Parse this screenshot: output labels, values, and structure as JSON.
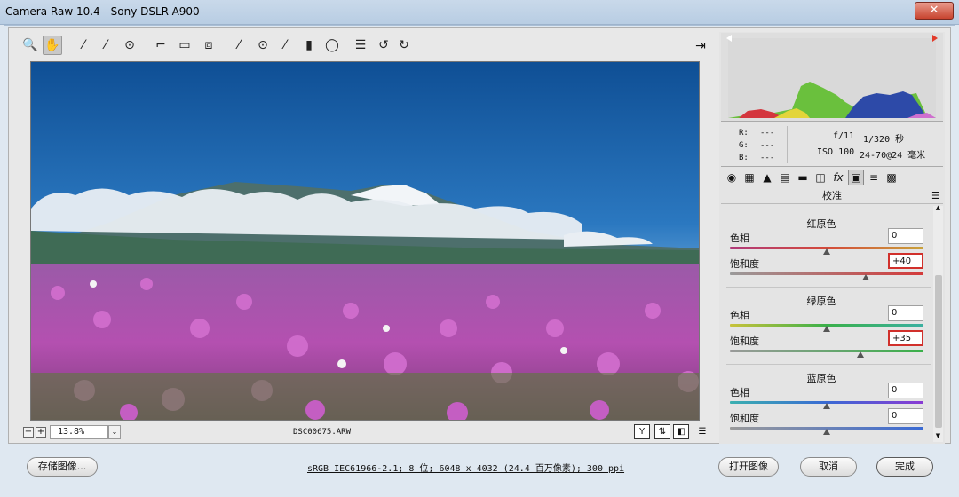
{
  "window": {
    "title": "Camera Raw 10.4 -  Sony DSLR-A900",
    "close_glyph": "✕"
  },
  "toolbar": {
    "tools": [
      {
        "name": "zoom-tool-icon",
        "glyph": "🔍"
      },
      {
        "name": "hand-tool-icon",
        "glyph": "✋"
      },
      {
        "name": "white-balance-tool-icon",
        "glyph": "⁄"
      },
      {
        "name": "color-sampler-tool-icon",
        "glyph": "⁄"
      },
      {
        "name": "targeted-adjustment-tool-icon",
        "glyph": "⊙"
      },
      {
        "name": "crop-tool-icon",
        "glyph": "⌐"
      },
      {
        "name": "straighten-tool-icon",
        "glyph": "▭"
      },
      {
        "name": "transform-tool-icon",
        "glyph": "⧈"
      },
      {
        "name": "spot-removal-tool-icon",
        "glyph": "⁄"
      },
      {
        "name": "red-eye-tool-icon",
        "glyph": "⊙"
      },
      {
        "name": "adjustment-brush-icon",
        "glyph": "⁄"
      },
      {
        "name": "graduated-filter-icon",
        "glyph": "▮"
      },
      {
        "name": "radial-filter-icon",
        "glyph": "◯"
      },
      {
        "name": "preferences-icon",
        "glyph": "☰"
      },
      {
        "name": "rotate-left-icon",
        "glyph": "↺"
      },
      {
        "name": "rotate-right-icon",
        "glyph": "↻"
      }
    ],
    "export_glyph": "⇥"
  },
  "preview": {
    "zoom_out": "−",
    "zoom_in": "+",
    "zoom_value": "13.8%",
    "zoom_dropdown": "⌄",
    "filename": "DSC00675.ARW",
    "icons": [
      {
        "name": "before-after-toggle-icon",
        "glyph": "Y"
      },
      {
        "name": "swap-settings-icon",
        "glyph": "⇅"
      },
      {
        "name": "copy-settings-icon",
        "glyph": "◧"
      },
      {
        "name": "default-settings-icon",
        "glyph": "☰"
      }
    ]
  },
  "info": {
    "r_label": "R:",
    "r_value": "---",
    "g_label": "G:",
    "g_value": "---",
    "b_label": "B:",
    "b_value": "---",
    "aperture": "f/11",
    "shutter": "1/320 秒",
    "iso": "ISO 100",
    "lens": "24-70@24 毫米"
  },
  "panel": {
    "title": "校准",
    "menu_glyph": "☰",
    "tabs": [
      {
        "name": "basic-tab-icon",
        "glyph": "◉"
      },
      {
        "name": "tone-curve-tab-icon",
        "glyph": "▦"
      },
      {
        "name": "detail-tab-icon",
        "glyph": "▲"
      },
      {
        "name": "hsl-tab-icon",
        "glyph": "▤"
      },
      {
        "name": "split-toning-tab-icon",
        "glyph": "▬"
      },
      {
        "name": "lens-corrections-tab-icon",
        "glyph": "◫"
      },
      {
        "name": "effects-tab-icon",
        "glyph": "fx"
      },
      {
        "name": "calibration-tab-icon",
        "glyph": "▣"
      },
      {
        "name": "presets-tab-icon",
        "glyph": "≡"
      },
      {
        "name": "snapshots-tab-icon",
        "glyph": "▩"
      }
    ],
    "groups": [
      {
        "title": "红原色",
        "hue_label": "色相",
        "hue_value": "0",
        "hue_level": 0,
        "sat_label": "饱和度",
        "sat_value": "+40",
        "sat_level": 40
      },
      {
        "title": "绿原色",
        "hue_label": "色相",
        "hue_value": "0",
        "hue_level": 0,
        "sat_label": "饱和度",
        "sat_value": "+35",
        "sat_level": 35
      },
      {
        "title": "蓝原色",
        "hue_label": "色相",
        "hue_value": "0",
        "hue_level": 0,
        "sat_label": "饱和度",
        "sat_value": "0",
        "sat_level": 0
      }
    ]
  },
  "bottom": {
    "save_label": "存储图像...",
    "status_text": "sRGB IEC61966-2.1; 8 位; 6048 x 4032 (24.4 百万像素); 300 ppi",
    "open_label": "打开图像",
    "cancel_label": "取消",
    "done_label": "完成"
  },
  "colors": {
    "highlight_box": "#d1302b",
    "sky": "#1a5a9e",
    "flowers": "#b04aa8"
  }
}
